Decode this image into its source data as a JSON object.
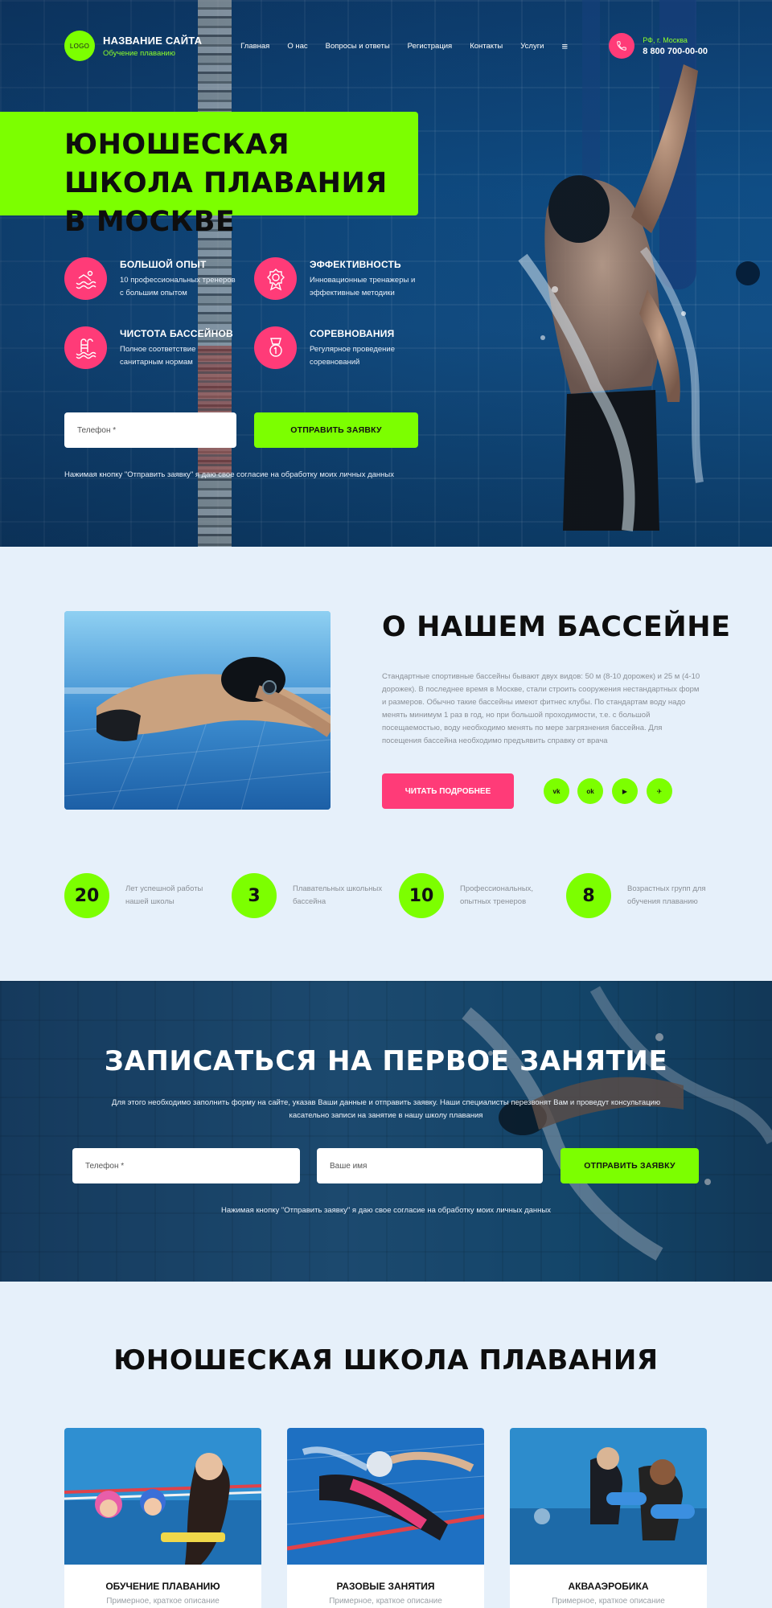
{
  "header": {
    "logo_text": "LOGO",
    "site_name": "НАЗВАНИЕ САЙТА",
    "site_subtitle": "Обучение плаванию",
    "nav": [
      "Главная",
      "О нас",
      "Вопросы и ответы",
      "Регистрация",
      "Контакты",
      "Услуги"
    ],
    "menu_glyph": "≡",
    "city": "РФ, г. Москва",
    "phone": "8 800 700-00-00"
  },
  "hero": {
    "title": "ЮНОШЕСКАЯ ШКОЛА ПЛАВАНИЯ В МОСКВЕ",
    "features": [
      {
        "icon": "swimmer-icon",
        "title": "БОЛЬШОЙ ОПЫТ",
        "text": "10 профессиональных тренеров с большим опытом"
      },
      {
        "icon": "medal-icon",
        "title": "ЭФФЕКТИВНОСТЬ",
        "text": "Инновационные тренажеры и эффективные методики"
      },
      {
        "icon": "pool-ladder-icon",
        "title": "ЧИСТОТА БАССЕЙНОВ",
        "text": "Полное соответствие санитарным нормам"
      },
      {
        "icon": "award-icon",
        "title": "СОРЕВНОВАНИЯ",
        "text": "Регулярное проведение соревнований"
      }
    ],
    "phone_placeholder": "Телефон *",
    "submit_label": "ОТПРАВИТЬ ЗАЯВКУ",
    "consent": "Нажимая кнопку \"Отправить заявку\" я даю свое согласие на обработку моих личных данных"
  },
  "about": {
    "title": "О НАШЕМ БАССЕЙНЕ",
    "text": "Стандартные спортивные бассейны бывают двух видов: 50 м (8-10 дорожек) и 25 м (4-10 дорожек). В последнее время в Москве, стали строить сооружения нестандартных форм и размеров. Обычно такие бассейны имеют фитнес клубы. По стандартам воду надо менять минимум 1 раз в год, но при большой проходимости, т.е. с большой посещаемостью, воду необходимо менять по мере загрязнения бассейна. Для посещения бассейна необходимо предъявить справку от врача",
    "more_label": "ЧИТАТЬ ПОДРОБНЕЕ",
    "socials": [
      "vk",
      "ok",
      "▶",
      "✈"
    ]
  },
  "stats": [
    {
      "value": "20",
      "text": "Лет успешной работы нашей школы"
    },
    {
      "value": "3",
      "text": "Плавательных школьных бассейна"
    },
    {
      "value": "10",
      "text": "Профессиональных, опытных тренеров"
    },
    {
      "value": "8",
      "text": "Возрастных групп для обучения плаванию"
    }
  ],
  "signup": {
    "title": "ЗАПИСАТЬСЯ НА ПЕРВОЕ ЗАНЯТИЕ",
    "text": "Для этого необходимо заполнить форму на сайте, указав Ваши данные и отправить заявку. Наши специалисты перезвонят Вам и проведут консультацию касательно записи на занятие в нашу школу плавания",
    "phone_placeholder": "Телефон *",
    "name_placeholder": "Ваше имя",
    "submit_label": "ОТПРАВИТЬ ЗАЯВКУ",
    "consent": "Нажимая кнопку \"Отправить заявку\" я даю свое согласие на обработку моих личных данных"
  },
  "school": {
    "title": "ЮНОШЕСКАЯ ШКОЛА ПЛАВАНИЯ",
    "cards": [
      {
        "title": "ОБУЧЕНИЕ ПЛАВАНИЮ",
        "desc": "Примерное, краткое описание"
      },
      {
        "title": "РАЗОВЫЕ ЗАНЯТИЯ",
        "desc": "Примерное, краткое описание"
      },
      {
        "title": "АКВААЭРОБИКА",
        "desc": "Примерное, краткое описание"
      }
    ]
  },
  "colors": {
    "accent_green": "#7cff00",
    "accent_pink": "#ff3b78",
    "page_bg": "#e6f0fa"
  }
}
